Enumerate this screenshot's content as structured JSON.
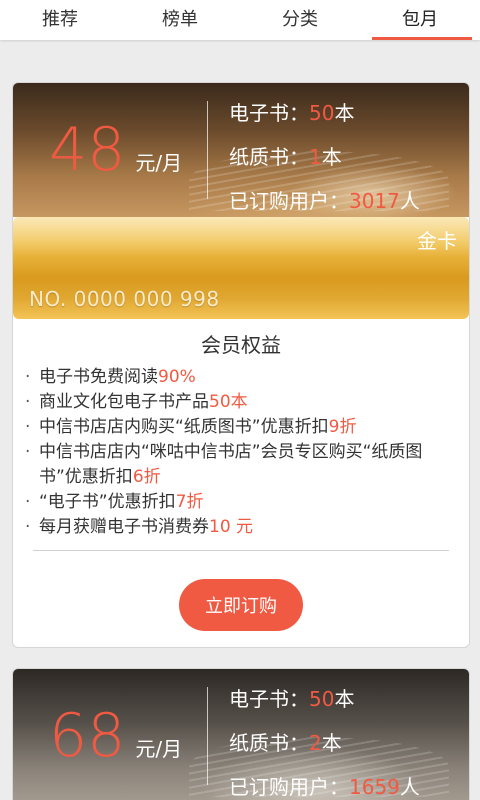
{
  "nav": {
    "tabs": [
      {
        "label": "推荐"
      },
      {
        "label": "榜单"
      },
      {
        "label": "分类"
      },
      {
        "label": "包月"
      }
    ]
  },
  "plans": [
    {
      "price": "48",
      "unit": "元/月",
      "ebook_label": "电子书：",
      "ebook_count": "50",
      "ebook_suffix": "本",
      "paper_label": "纸质书：",
      "paper_count": "1",
      "paper_suffix": "本",
      "subs_label": "已订购用户：",
      "subs_count": "3017",
      "subs_suffix": "人",
      "card_name": "金卡",
      "card_number": "NO. 0000 000 998",
      "benefits_title": "会员权益",
      "benefits": [
        {
          "text": "电子书免费阅读",
          "hl": "90%"
        },
        {
          "text": "商业文化包电子书产品",
          "hl": "50本"
        },
        {
          "text": "中信书店店内购买“纸质图书”优惠折扣",
          "hl": "9折"
        },
        {
          "text": "中信书店店内“咪咕中信书店”会员专区购买“纸质图书”优惠折扣",
          "hl": "6折"
        },
        {
          "text": "“电子书”优惠折扣",
          "hl": "7折"
        },
        {
          "text": "每月获赠电子书消费券",
          "hl": "10 元"
        }
      ],
      "cta": "立即订购"
    },
    {
      "price": "68",
      "unit": "元/月",
      "ebook_label": "电子书：",
      "ebook_count": "50",
      "ebook_suffix": "本",
      "paper_label": "纸质书：",
      "paper_count": "2",
      "paper_suffix": "本",
      "subs_label": "已订购用户：",
      "subs_count": "1659",
      "subs_suffix": "人"
    }
  ],
  "colors": {
    "accent": "#f15a42",
    "gold": "#e3a52c",
    "background": "#ececec"
  }
}
